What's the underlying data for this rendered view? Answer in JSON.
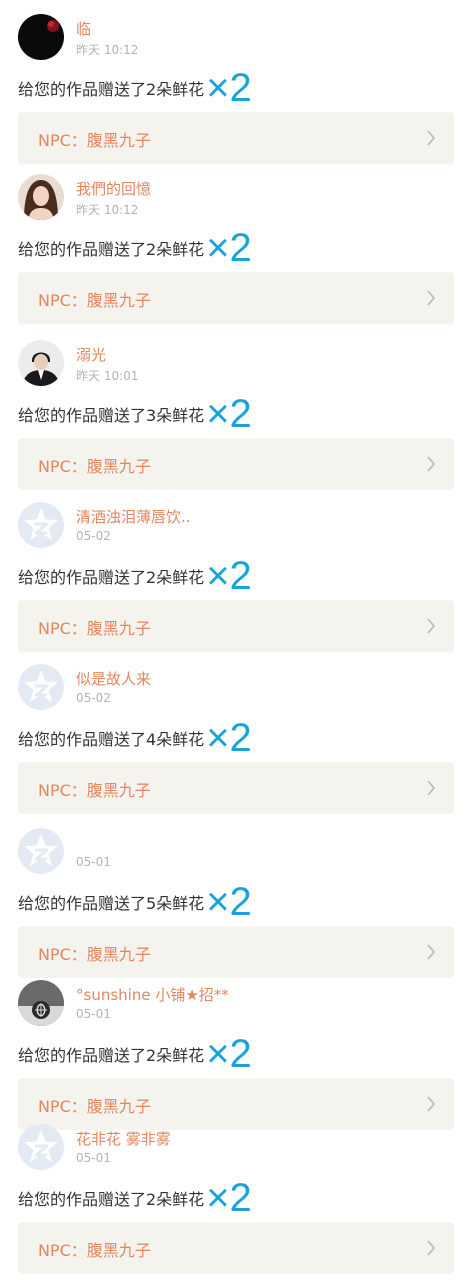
{
  "feed": [
    {
      "avatar": "dark-red-avatar",
      "username": "临",
      "time": "昨天 10:12",
      "message": "给您的作品赠送了2朵鲜花",
      "multiplier": "×2",
      "npc_label": "NPC：腹黑九子"
    },
    {
      "avatar": "woman-portrait-avatar",
      "username": "我們的回憶",
      "time": "昨天 10:12",
      "message": "给您的作品赠送了2朵鲜花",
      "multiplier": "×2",
      "npc_label": "NPC：腹黑九子"
    },
    {
      "avatar": "man-portrait-avatar",
      "username": "溺光",
      "time": "昨天 10:01",
      "message": "给您的作品赠送了3朵鲜花",
      "multiplier": "×2",
      "npc_label": "NPC：腹黑九子"
    },
    {
      "avatar": "default-star-avatar",
      "username": "清酒浊泪薄唇饮..",
      "time": "05-02",
      "message": "给您的作品赠送了2朵鲜花",
      "multiplier": "×2",
      "npc_label": "NPC：腹黑九子"
    },
    {
      "avatar": "default-star-avatar",
      "username": "似是故人来",
      "time": "05-02",
      "message": "给您的作品赠送了4朵鲜花",
      "multiplier": "×2",
      "npc_label": "NPC：腹黑九子"
    },
    {
      "avatar": "default-star-avatar",
      "username": "",
      "time": "05-01",
      "message": "给您的作品赠送了5朵鲜花",
      "multiplier": "×2",
      "npc_label": "NPC：腹黑九子"
    },
    {
      "avatar": "photo-swirl-avatar",
      "username": "°sunshine 小铺★招**",
      "time": "05-01",
      "message": "给您的作品赠送了2朵鲜花",
      "multiplier": "×2",
      "npc_label": "NPC：腹黑九子"
    },
    {
      "avatar": "default-star-avatar",
      "username": "花非花 雾非雾",
      "time": "05-01",
      "message": "给您的作品赠送了2朵鲜花",
      "multiplier": "×2",
      "npc_label": "NPC：腹黑九子"
    }
  ],
  "colors": {
    "username": "#e2875f",
    "time": "#b3b3b3",
    "message": "#333333",
    "multiplier": "#1aa3d9",
    "npc_background": "#f4f3ee"
  }
}
